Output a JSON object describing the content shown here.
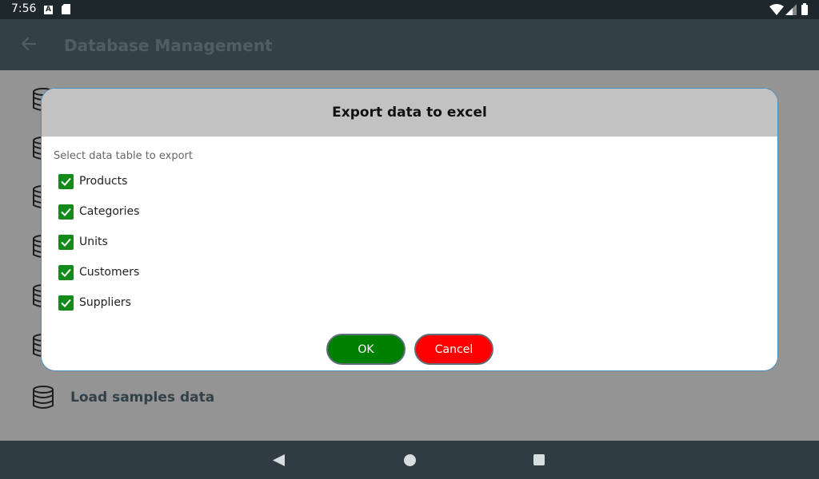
{
  "status_bar": {
    "time": "7:56",
    "notification_a": "A"
  },
  "app_bar": {
    "title": "Database Management"
  },
  "background_list": {
    "last_item_label": "Load samples data"
  },
  "dialog": {
    "title": "Export data to excel",
    "subtitle": "Select data table to export",
    "tables": [
      {
        "label": "Products",
        "checked": true
      },
      {
        "label": "Categories",
        "checked": true
      },
      {
        "label": "Units",
        "checked": true
      },
      {
        "label": "Customers",
        "checked": true
      },
      {
        "label": "Suppliers",
        "checked": true
      }
    ],
    "ok_label": "OK",
    "cancel_label": "Cancel"
  },
  "colors": {
    "ok_button": "#008000",
    "cancel_button": "#ff0000",
    "checkbox": "#138a1a",
    "app_bar": "#56707d"
  }
}
